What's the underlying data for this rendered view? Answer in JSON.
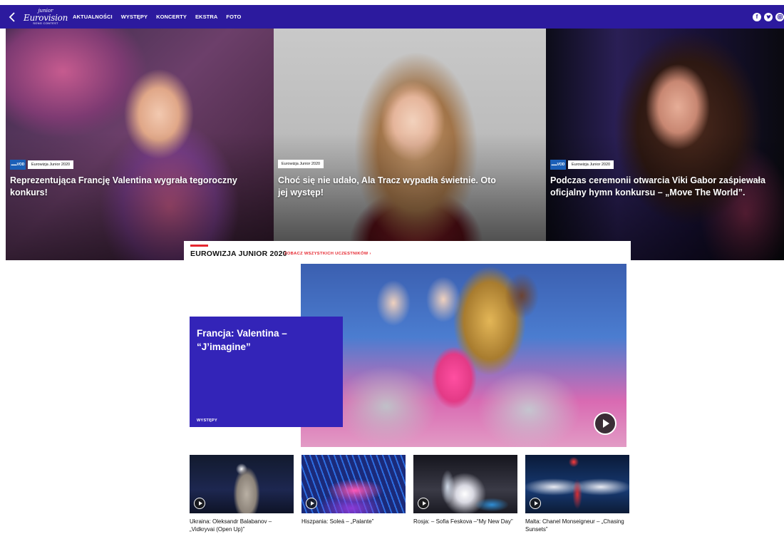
{
  "nav": {
    "back_icon": "chevron-left-icon",
    "logo": {
      "line1": "junior",
      "line2": "Eurovision",
      "line3": "SONG CONTEST"
    },
    "menu": [
      "AKTUALNOŚCI",
      "WYSTĘPY",
      "KONCERTY",
      "EKSTRA",
      "FOTO"
    ],
    "social_icons": [
      "facebook-icon",
      "twitter-icon",
      "instagram-icon"
    ],
    "brand_color": "#2c1a9e"
  },
  "hero": [
    {
      "vod": "VOD",
      "tag": "Eurowizja Junior 2020",
      "title": "Reprezentująca Francję Valentina wygrała tegoroczny konkurs!"
    },
    {
      "vod": "",
      "tag": "Eurowizja Junior 2020",
      "title": "Choć się nie udało, Ala Tracz wypadła świetnie. Oto jej występ!"
    },
    {
      "vod": "VOD",
      "tag": "Eurowizja Junior 2020",
      "title": "Podczas ceremonii otwarcia Viki Gabor zaśpiewała oficjalny hymn konkursu – „Move The World”."
    }
  ],
  "section": {
    "title": "EUROWIZJA JUNIOR 2020",
    "link": "ZOBACZ WSZYSTKICH UCZESTNIKÓW ›",
    "accent": "#e5262f",
    "feature": {
      "title": "Francja: Valentina – “J’imagine”",
      "category": "WYSTĘPY",
      "box_color": "#3324b8",
      "play_icon": "play-icon"
    },
    "thumbs": [
      {
        "caption": "Ukraina: Oleksandr Balabanov – „Vidkryvai (Open Up)”"
      },
      {
        "caption": "Hiszpania: Soleá – „Palante”"
      },
      {
        "caption": "Rosja: – Sofia Feskova –“My New Day”"
      },
      {
        "caption": "Malta: Chanel Monseigneur – „Chasing Sunsets”"
      }
    ]
  }
}
